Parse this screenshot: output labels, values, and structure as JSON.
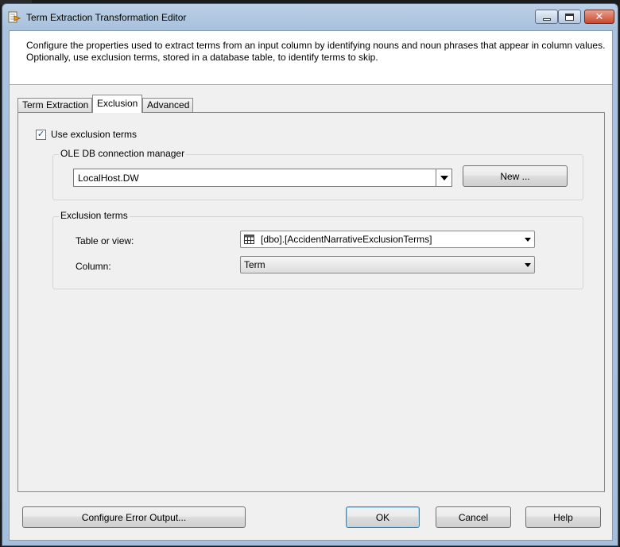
{
  "window": {
    "title": "Term Extraction Transformation Editor"
  },
  "header": {
    "description": "Configure the properties used to extract terms from an input column by identifying nouns and noun phrases that appear in column values. Optionally, use exclusion terms, stored in a database table, to identify terms to skip."
  },
  "tabs": [
    {
      "label": "Term Extraction",
      "active": false
    },
    {
      "label": "Exclusion",
      "active": true
    },
    {
      "label": "Advanced",
      "active": false
    }
  ],
  "exclusion": {
    "use_exclusion_label": "Use exclusion terms",
    "use_exclusion_checked": true,
    "oledb_group_label": "OLE DB connection manager",
    "connection_value": "LocalHost.DW",
    "new_button_label": "New ...",
    "terms_group_label": "Exclusion terms",
    "table_label": "Table or view:",
    "table_value": "[dbo].[AccidentNarrativeExclusionTerms]",
    "column_label": "Column:",
    "column_value": "Term"
  },
  "footer": {
    "configure_error_label": "Configure Error Output...",
    "ok_label": "OK",
    "cancel_label": "Cancel",
    "help_label": "Help"
  },
  "icons": {
    "title": "editor-icon",
    "table": "table-icon",
    "checkbox_mark": "✓"
  },
  "colors": {
    "title_bar": "#aac2dd",
    "close_button": "#c8482f",
    "default_button_border": "#3c7fb1"
  }
}
